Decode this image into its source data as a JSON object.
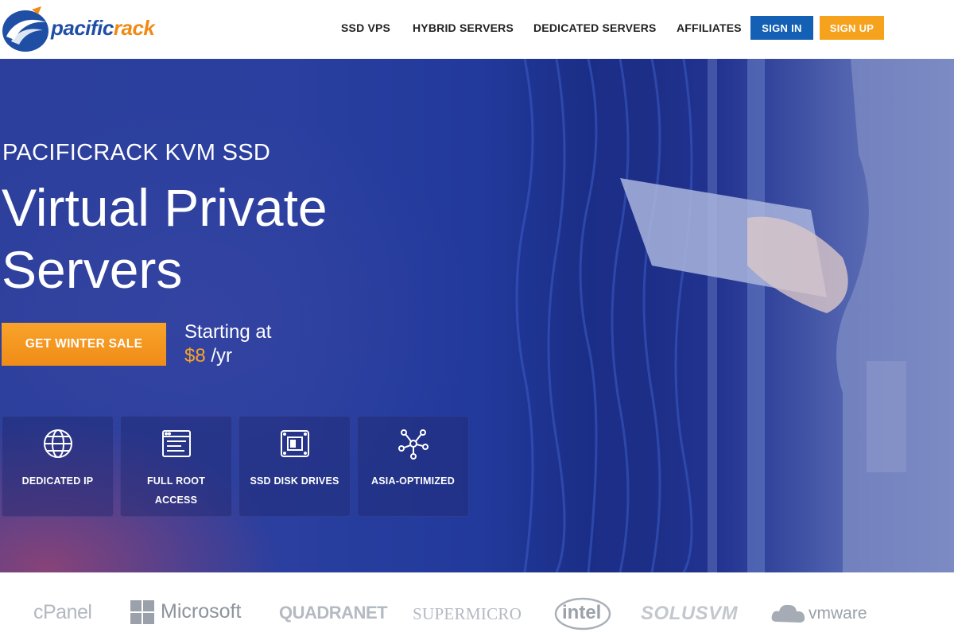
{
  "brand": {
    "part1": "pacific",
    "part2": "rack"
  },
  "nav": {
    "items": [
      "SSD VPS",
      "HYBRID SERVERS",
      "DEDICATED SERVERS",
      "AFFILIATES"
    ],
    "signin": "SIGN IN",
    "signup": "SIGN UP"
  },
  "hero": {
    "subtitle": "PACIFICRACK KVM SSD",
    "title_line1": "Virtual Private",
    "title_line2": "Servers",
    "cta": "GET WINTER SALE",
    "price_label": "Starting at",
    "price_amount": "$8",
    "price_period": "/yr"
  },
  "features": [
    {
      "label": "DEDICATED IP",
      "icon": "globe-icon"
    },
    {
      "label": "FULL ROOT ACCESS",
      "icon": "terminal-window-icon"
    },
    {
      "label": "SSD DISK DRIVES",
      "icon": "ssd-drive-icon"
    },
    {
      "label": "ASIA-OPTIMIZED",
      "icon": "network-nodes-icon"
    }
  ],
  "partners": [
    "cPanel",
    "Microsoft",
    "QUADRANET",
    "SUPERMICRO",
    "intel",
    "SOLUSVM",
    "vmware"
  ],
  "colors": {
    "accent_orange": "#f6a21c",
    "signin_blue": "#1460b4",
    "brand_blue": "#1f4fa5"
  }
}
